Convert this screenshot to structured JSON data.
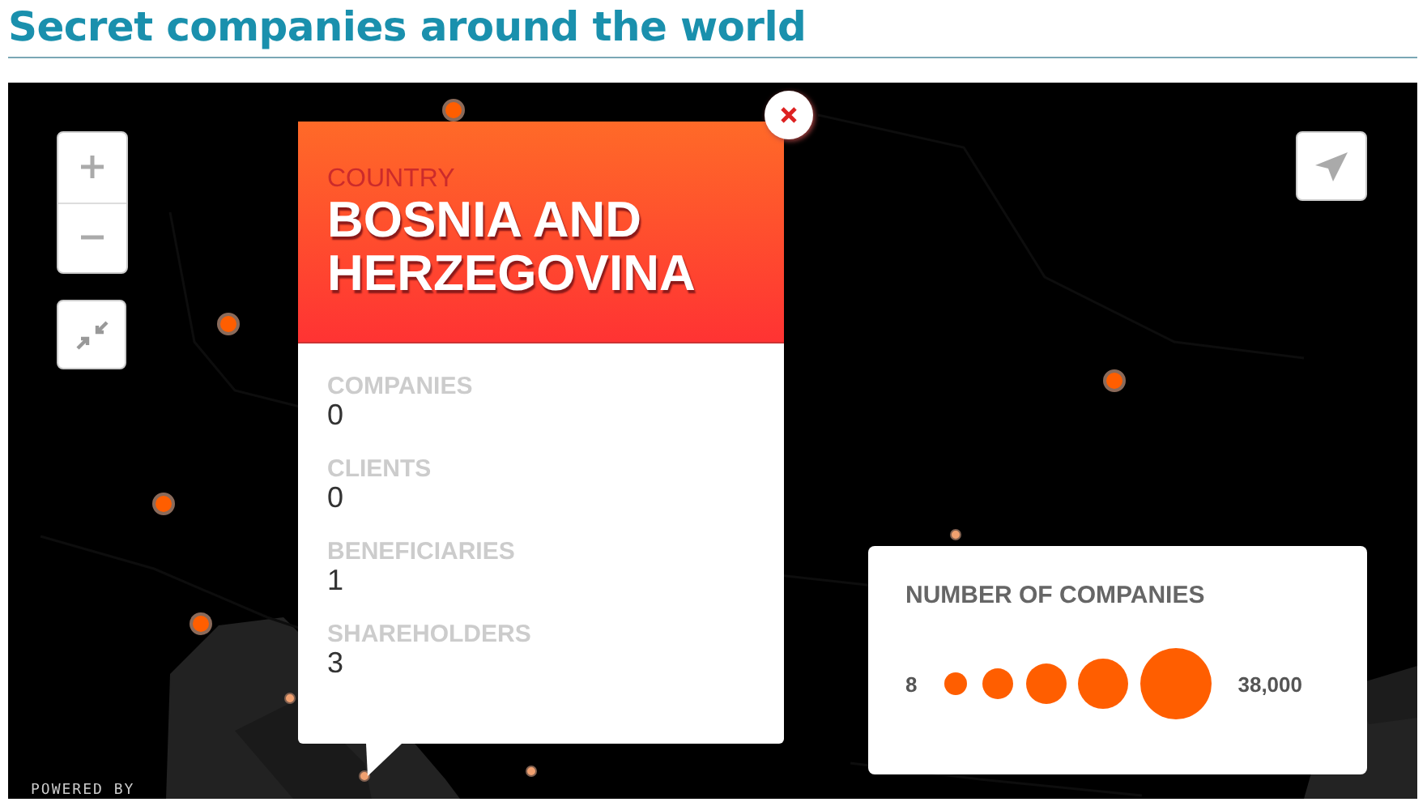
{
  "title": "Secret companies around the world",
  "map": {
    "attribution": "POWERED BY"
  },
  "popup": {
    "label": "COUNTRY",
    "name": "BOSNIA AND HERZEGOVINA",
    "stats": [
      {
        "label": "COMPANIES",
        "value": "0"
      },
      {
        "label": "CLIENTS",
        "value": "0"
      },
      {
        "label": "BENEFICIARIES",
        "value": "1"
      },
      {
        "label": "SHAREHOLDERS",
        "value": "3"
      }
    ]
  },
  "legend": {
    "title": "NUMBER OF COMPANIES",
    "min": "8",
    "max": "38,000"
  }
}
